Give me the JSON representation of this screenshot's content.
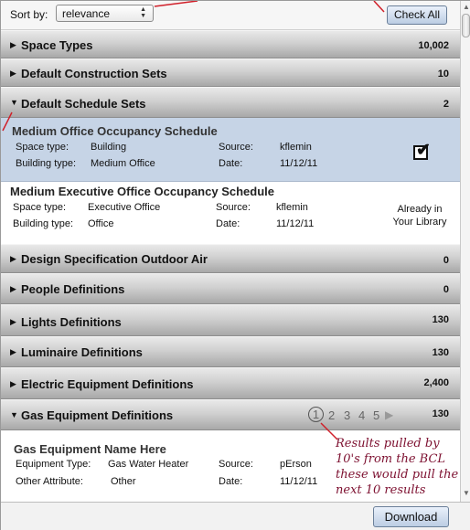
{
  "sort": {
    "label": "Sort by:",
    "value": "relevance"
  },
  "check_all_label": "Check All",
  "categories": [
    {
      "name": "Space Types",
      "count": "10,002",
      "expanded": false
    },
    {
      "name": "Default Construction Sets",
      "count": "10",
      "expanded": false
    },
    {
      "name": "Default Schedule Sets",
      "count": "2",
      "expanded": true
    },
    {
      "name": "Design Specification Outdoor Air",
      "count": "0",
      "expanded": false
    },
    {
      "name": "People Definitions",
      "count": "0",
      "expanded": false
    },
    {
      "name": "Lights Definitions",
      "count": "130",
      "expanded": false
    },
    {
      "name": "Luminaire Definitions",
      "count": "130",
      "expanded": false
    },
    {
      "name": "Electric Equipment Definitions",
      "count": "2,400",
      "expanded": false
    },
    {
      "name": "Gas Equipment Definitions",
      "count": "130",
      "expanded": true
    }
  ],
  "schedule_results": [
    {
      "title": "Medium Office Occupancy Schedule",
      "fields": [
        {
          "label": "Space type:",
          "value": "Building"
        },
        {
          "label": "Building type:",
          "value": "Medium Office"
        }
      ],
      "meta": [
        {
          "label": "Source:",
          "value": "kflemin"
        },
        {
          "label": "Date:",
          "value": "11/12/11"
        }
      ],
      "checked": true,
      "selected": true
    },
    {
      "title": "Medium Executive Office Occupancy Schedule",
      "fields": [
        {
          "label": "Space type:",
          "value": "Executive Office"
        },
        {
          "label": "Building type:",
          "value": "Office"
        }
      ],
      "meta": [
        {
          "label": "Source:",
          "value": "kflemin"
        },
        {
          "label": "Date:",
          "value": "11/12/11"
        }
      ],
      "status_line1": "Already in",
      "status_line2": "Your Library"
    }
  ],
  "gas_results": [
    {
      "title": "Gas Equipment Name Here",
      "fields": [
        {
          "label": "Equipment Type:",
          "value": "Gas Water Heater"
        },
        {
          "label": "Other Attribute:",
          "value": "Other"
        }
      ],
      "meta": [
        {
          "label": "Source:",
          "value": "pErson"
        },
        {
          "label": "Date:",
          "value": "11/12/11"
        }
      ]
    }
  ],
  "pagination": {
    "pages": [
      "1",
      "2",
      "3",
      "4",
      "5"
    ],
    "current": "1",
    "next_icon": "▶"
  },
  "annotation": "Results pulled by 10's from the BCL these would pull the next 10 results",
  "download_label": "Download",
  "colors": {
    "selected_row": "#c6d4e6",
    "annotation": "#7d1030",
    "annotation_line": "#d0202a"
  }
}
